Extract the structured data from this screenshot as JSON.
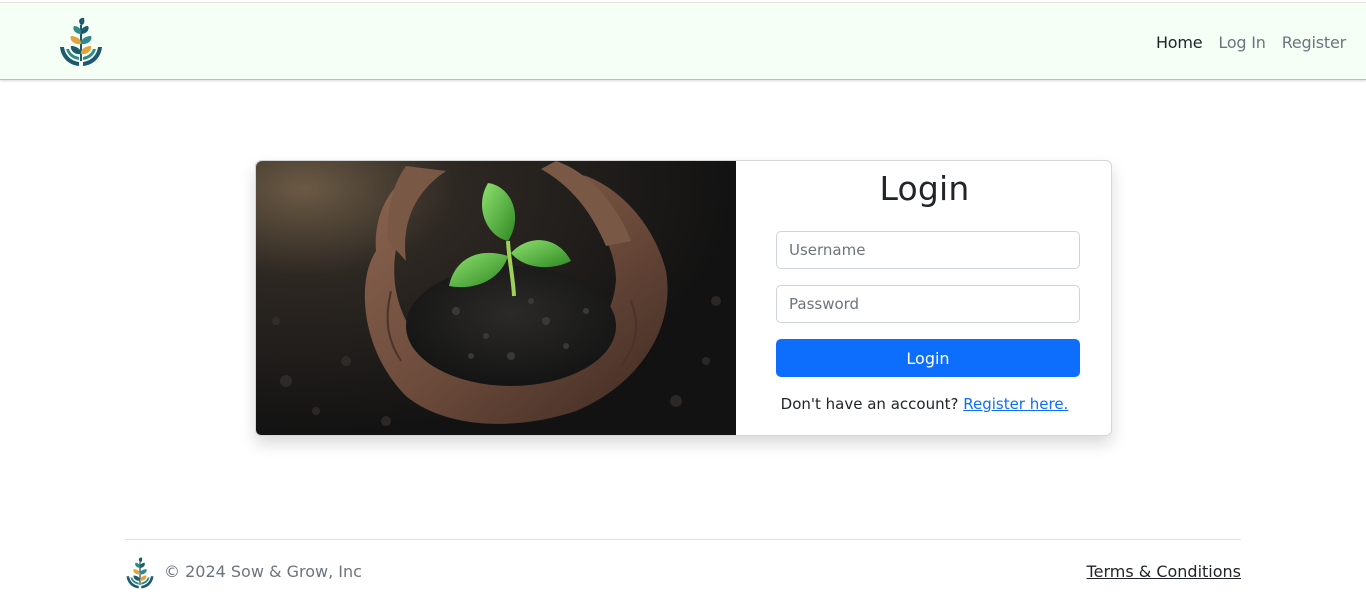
{
  "brand": {
    "logo_icon": "sprout-in-hands-logo-icon",
    "colors": {
      "leaf_dark": "#1d5a6b",
      "leaf_light": "#2f8a8a",
      "accent": "#e4a33a"
    }
  },
  "nav": {
    "links": [
      {
        "label": "Home",
        "active": true
      },
      {
        "label": "Log In",
        "active": false
      },
      {
        "label": "Register",
        "active": false
      }
    ]
  },
  "login": {
    "hero_image": "seedling-in-soil-hands-image",
    "title": "Login",
    "username_placeholder": "Username",
    "username_value": "",
    "password_placeholder": "Password",
    "password_value": "",
    "submit_label": "Login",
    "register_prompt": "Don't have an account?",
    "register_link": "Register here."
  },
  "footer": {
    "copyright": "© 2024 Sow & Grow, Inc",
    "terms_link": "Terms & Conditions"
  },
  "colors": {
    "navbar_bg": "#f5fff6",
    "primary": "#0d6efd",
    "link": "#0d6efd",
    "muted_text": "#6c757d"
  }
}
